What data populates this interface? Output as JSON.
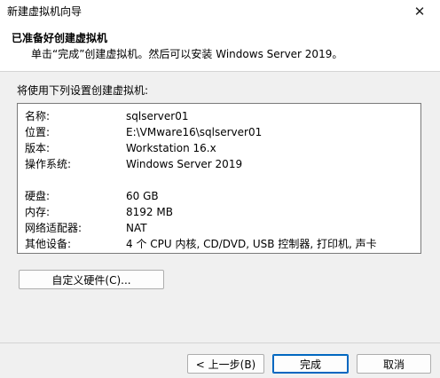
{
  "window": {
    "title": "新建虚拟机向导",
    "close_glyph": "✕"
  },
  "header": {
    "title": "已准备好创建虚拟机",
    "subtitle": "单击“完成”创建虚拟机。然后可以安装 Windows Server 2019。"
  },
  "main": {
    "prompt": "将使用下列设置创建虚拟机:",
    "settings": [
      {
        "key": "名称:",
        "value": "sqlserver01"
      },
      {
        "key": "位置:",
        "value": "E:\\VMware16\\sqlserver01"
      },
      {
        "key": "版本:",
        "value": "Workstation 16.x"
      },
      {
        "key": "操作系统:",
        "value": "Windows Server 2019"
      },
      {
        "key": "硬盘:",
        "value": "60 GB"
      },
      {
        "key": "内存:",
        "value": "8192 MB"
      },
      {
        "key": "网络适配器:",
        "value": "NAT"
      },
      {
        "key": "其他设备:",
        "value": "4 个 CPU 内核, CD/DVD, USB 控制器, 打印机, 声卡"
      }
    ],
    "customize_button": "自定义硬件(C)..."
  },
  "footer": {
    "back_button": "< 上一步(B)",
    "finish_button": "完成",
    "cancel_button": "取消"
  }
}
